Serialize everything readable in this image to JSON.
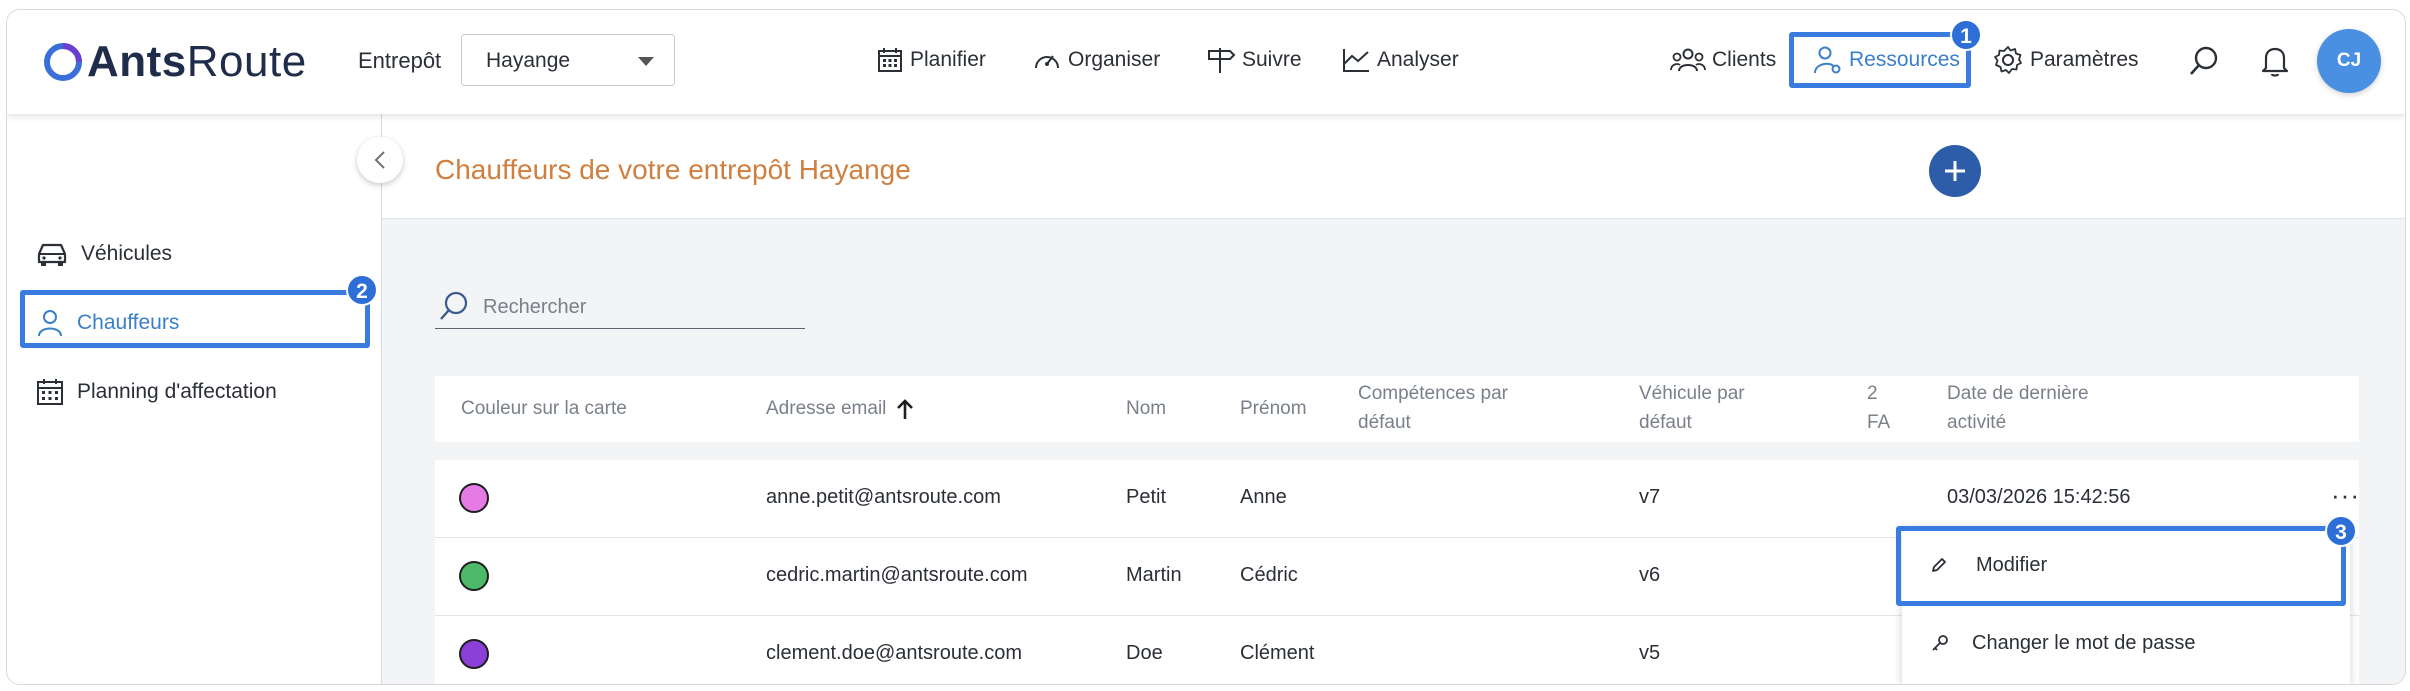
{
  "app": {
    "brand_bold": "Ants",
    "brand_light": "Route"
  },
  "header": {
    "entrepot_label": "Entrepôt",
    "entrepot_value": "Hayange",
    "nav": {
      "planifier": "Planifier",
      "organiser": "Organiser",
      "suivre": "Suivre",
      "analyser": "Analyser",
      "clients": "Clients",
      "ressources": "Ressources",
      "parametres": "Paramètres"
    },
    "avatar_initials": "CJ"
  },
  "sidebar": {
    "items": [
      {
        "label": "Véhicules",
        "icon": "car-icon"
      },
      {
        "label": "Chauffeurs",
        "icon": "user-icon"
      },
      {
        "label": "Planning d'affectation",
        "icon": "calendar-icon"
      }
    ]
  },
  "main": {
    "title": "Chauffeurs de votre entrepôt Hayange",
    "search_placeholder": "Rechercher",
    "columns": {
      "couleur": "Couleur sur la carte",
      "email": "Adresse email",
      "nom": "Nom",
      "prenom": "Prénom",
      "competences_1": "Compétences par",
      "competences_2": "défaut",
      "vehicule_1": "Véhicule par",
      "vehicule_2": "défaut",
      "fa_1": "2",
      "fa_2": "FA",
      "activite_1": "Date de dernière",
      "activite_2": "activité"
    },
    "rows": [
      {
        "color": "#e67be6",
        "email": "anne.petit@antsroute.com",
        "nom": "Petit",
        "prenom": "Anne",
        "vehicule": "v7",
        "activite": "03/03/2026 15:42:56"
      },
      {
        "color": "#4cba6a",
        "email": "cedric.martin@antsroute.com",
        "nom": "Martin",
        "prenom": "Cédric",
        "vehicule": "v6",
        "activite": ""
      },
      {
        "color": "#8a3fd6",
        "email": "clement.doe@antsroute.com",
        "nom": "Doe",
        "prenom": "Clément",
        "vehicule": "v5",
        "activite": ""
      }
    ],
    "more_label": "···"
  },
  "context_menu": {
    "modifier": "Modifier",
    "changer_mdp": "Changer le mot de passe"
  },
  "annotations": {
    "b1": "1",
    "b2": "2",
    "b3": "3"
  },
  "colors": {
    "accent": "#3a7be0",
    "title": "#d07f3e",
    "add_button": "#2d5da8"
  }
}
